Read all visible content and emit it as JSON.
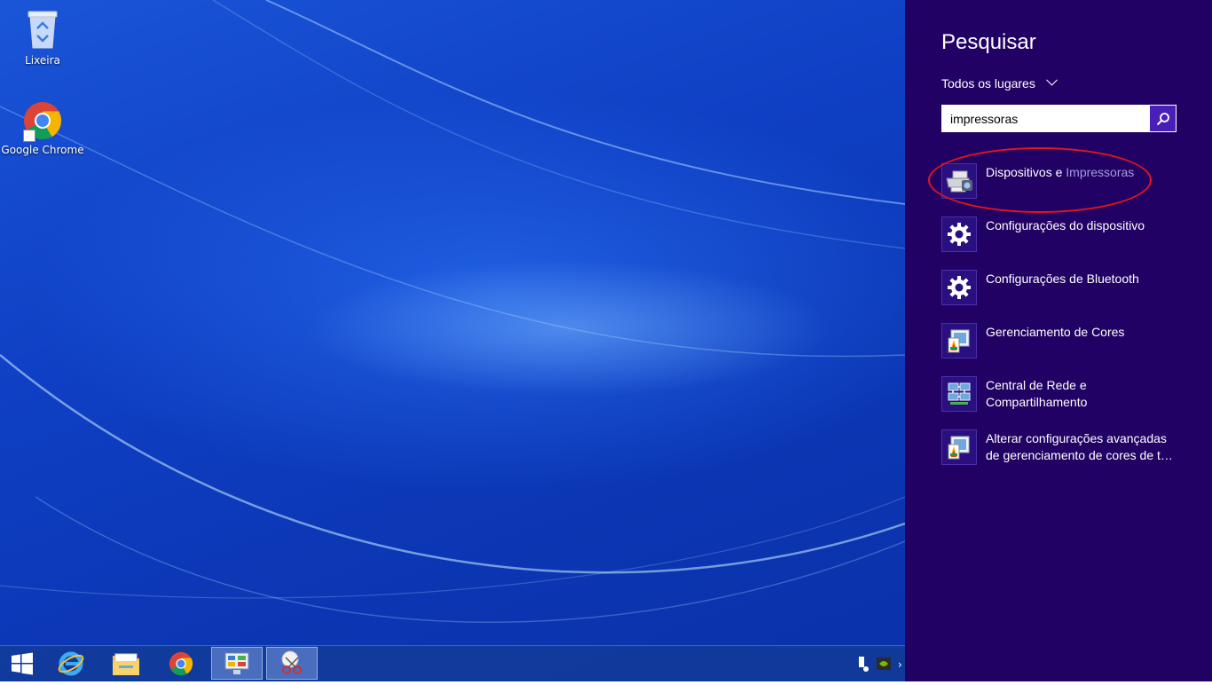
{
  "desktop": {
    "icons": [
      {
        "label": "Lixeira",
        "icon": "recycle-bin-icon"
      },
      {
        "label": "Google Chrome",
        "icon": "chrome-icon"
      }
    ]
  },
  "taskbar": {
    "items": [
      {
        "name": "start-button",
        "icon": "windows-logo-icon"
      },
      {
        "name": "internet-explorer",
        "icon": "internet-explorer-icon"
      },
      {
        "name": "file-explorer",
        "icon": "folder-icon"
      },
      {
        "name": "chrome",
        "icon": "chrome-icon"
      },
      {
        "name": "control-panel",
        "icon": "control-panel-icon",
        "active": true
      },
      {
        "name": "snipping-tool",
        "icon": "scissors-icon",
        "active": true
      }
    ]
  },
  "search": {
    "title": "Pesquisar",
    "scope": "Todos os lugares",
    "query": "impressoras",
    "results": [
      {
        "label": "Dispositivos e ",
        "highlight": "Impressoras",
        "icon": "devices-printers-icon"
      },
      {
        "label": "Configurações do dispositivo",
        "icon": "gear-icon"
      },
      {
        "label": "Configurações de Bluetooth",
        "icon": "gear-icon"
      },
      {
        "label": "Gerenciamento de Cores",
        "icon": "color-management-icon"
      },
      {
        "label": "Central de Rede e Compartilhamento",
        "icon": "network-icon"
      },
      {
        "label": "Alterar configurações avançadas de gerenciamento de cores de t…",
        "icon": "color-management-icon"
      }
    ]
  },
  "colors": {
    "pane_bg": "#210264",
    "highlight_text": "#a99be0",
    "annotation_ring": "#e8141c"
  }
}
